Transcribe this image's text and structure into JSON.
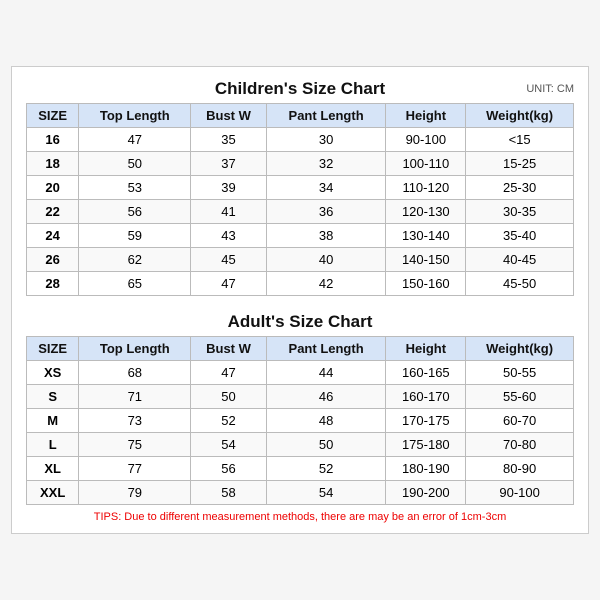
{
  "page": {
    "unit": "UNIT: CM",
    "children": {
      "title": "Children's Size Chart",
      "headers": [
        "SIZE",
        "Top Length",
        "Bust W",
        "Pant Length",
        "Height",
        "Weight(kg)"
      ],
      "rows": [
        [
          "16",
          "47",
          "35",
          "30",
          "90-100",
          "<15"
        ],
        [
          "18",
          "50",
          "37",
          "32",
          "100-110",
          "15-25"
        ],
        [
          "20",
          "53",
          "39",
          "34",
          "110-120",
          "25-30"
        ],
        [
          "22",
          "56",
          "41",
          "36",
          "120-130",
          "30-35"
        ],
        [
          "24",
          "59",
          "43",
          "38",
          "130-140",
          "35-40"
        ],
        [
          "26",
          "62",
          "45",
          "40",
          "140-150",
          "40-45"
        ],
        [
          "28",
          "65",
          "47",
          "42",
          "150-160",
          "45-50"
        ]
      ]
    },
    "adults": {
      "title": "Adult's Size Chart",
      "headers": [
        "SIZE",
        "Top Length",
        "Bust W",
        "Pant Length",
        "Height",
        "Weight(kg)"
      ],
      "rows": [
        [
          "XS",
          "68",
          "47",
          "44",
          "160-165",
          "50-55"
        ],
        [
          "S",
          "71",
          "50",
          "46",
          "160-170",
          "55-60"
        ],
        [
          "M",
          "73",
          "52",
          "48",
          "170-175",
          "60-70"
        ],
        [
          "L",
          "75",
          "54",
          "50",
          "175-180",
          "70-80"
        ],
        [
          "XL",
          "77",
          "56",
          "52",
          "180-190",
          "80-90"
        ],
        [
          "XXL",
          "79",
          "58",
          "54",
          "190-200",
          "90-100"
        ]
      ]
    },
    "tips": "TIPS: Due to different measurement methods, there are may be an error of 1cm-3cm"
  }
}
